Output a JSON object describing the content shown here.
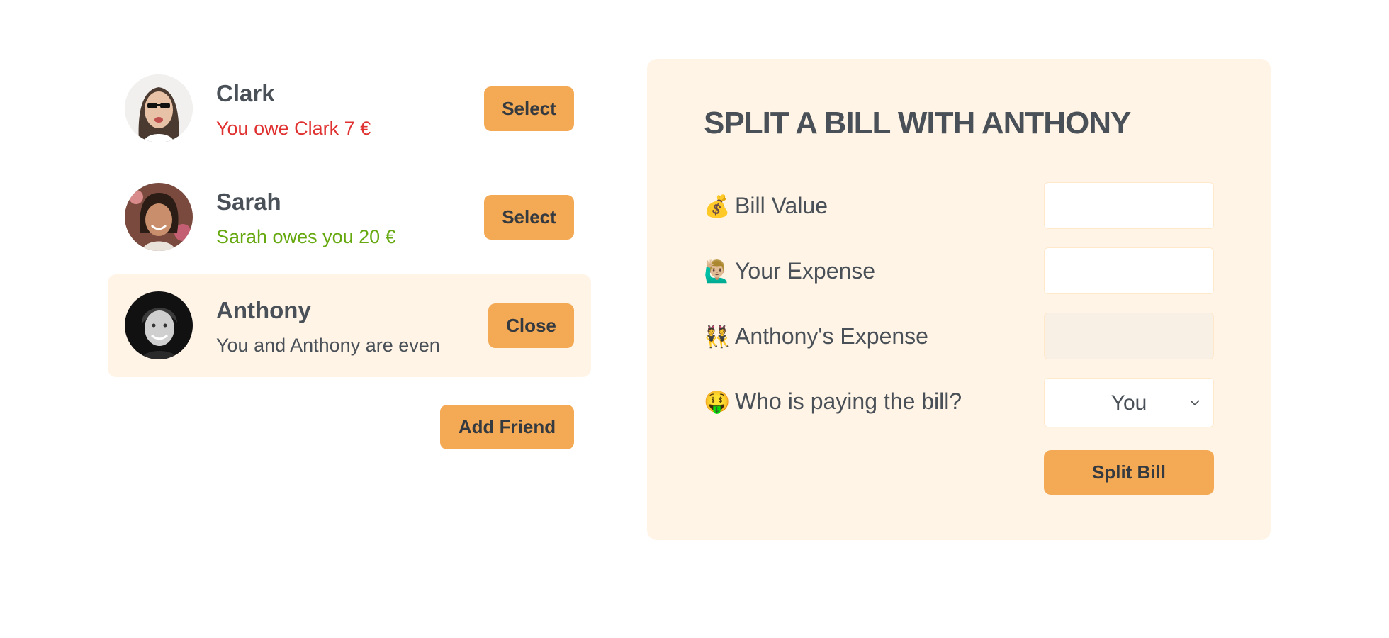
{
  "friends": [
    {
      "name": "Clark",
      "status": "You owe Clark 7 €",
      "status_type": "owe",
      "button_label": "Select",
      "selected": false
    },
    {
      "name": "Sarah",
      "status": "Sarah owes you 20 €",
      "status_type": "owed",
      "button_label": "Select",
      "selected": false
    },
    {
      "name": "Anthony",
      "status": "You and Anthony are even",
      "status_type": "even",
      "button_label": "Close",
      "selected": true
    }
  ],
  "add_friend_label": "Add Friend",
  "split_form": {
    "title": "SPLIT A BILL WITH ANTHONY",
    "bill_value": {
      "emoji": "💰",
      "label": "Bill Value",
      "value": ""
    },
    "your_expense": {
      "emoji": "🙋🏼‍♂️",
      "label": "Your Expense",
      "value": ""
    },
    "friend_expense": {
      "emoji": "👯",
      "label": "Anthony's Expense",
      "value": ""
    },
    "payer": {
      "emoji": "🤑",
      "label": "Who is paying the bill?",
      "selected": "You"
    },
    "submit_label": "Split Bill"
  },
  "colors": {
    "accent": "#f4a954",
    "panel_background": "#fff4e6",
    "owe_red": "#e03131",
    "owed_green": "#66a80f",
    "text": "#495057"
  }
}
